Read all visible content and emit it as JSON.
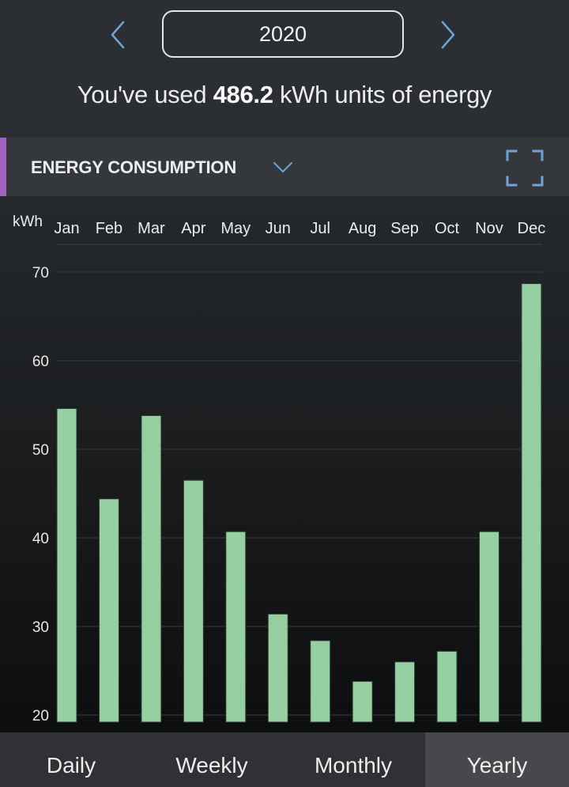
{
  "header": {
    "year": "2020",
    "prev_icon": "chevron-left-icon",
    "next_icon": "chevron-right-icon"
  },
  "summary": {
    "prefix": "You've used ",
    "value": "486.2",
    "suffix": " kWh units of energy"
  },
  "panel": {
    "title": "ENERGY CONSUMPTION",
    "dropdown_icon": "chevron-down-icon",
    "expand_icon": "expand-icon"
  },
  "colors": {
    "accent": "#a463c0",
    "bar": "#96d0a2",
    "icon_blue": "#6fa3d8"
  },
  "chart_data": {
    "type": "bar",
    "title": "ENERGY CONSUMPTION",
    "xlabel": "",
    "ylabel": "kWh",
    "categories": [
      "Jan",
      "Feb",
      "Mar",
      "Apr",
      "May",
      "Jun",
      "Jul",
      "Aug",
      "Sep",
      "Oct",
      "Nov",
      "Dec"
    ],
    "values": [
      54.6,
      44.4,
      53.8,
      46.5,
      40.7,
      31.4,
      28.4,
      23.8,
      26.0,
      27.2,
      40.7,
      68.7
    ],
    "yticks": [
      20,
      30,
      40,
      50,
      60,
      70
    ],
    "ylim": [
      19.2,
      73
    ],
    "grid": true,
    "x_labels_position": "top",
    "legend": "none"
  },
  "tabs": [
    {
      "label": "Daily",
      "active": false
    },
    {
      "label": "Weekly",
      "active": false
    },
    {
      "label": "Monthly",
      "active": false
    },
    {
      "label": "Yearly",
      "active": true
    }
  ]
}
